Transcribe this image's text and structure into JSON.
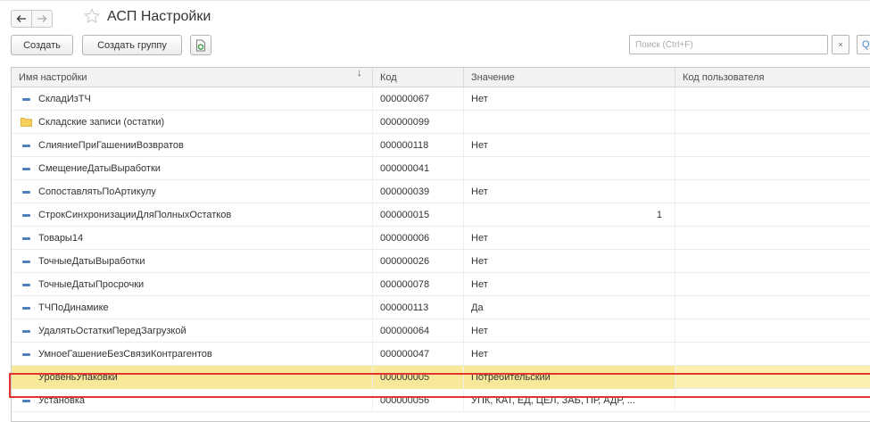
{
  "window": {
    "title": "АСП Настройки"
  },
  "toolbar": {
    "create_label": "Создать",
    "create_group_label": "Создать группу",
    "search_placeholder": "Поиск (Ctrl+F)",
    "clear_label": "×",
    "find_label": "Q"
  },
  "table": {
    "columns": {
      "name": "Имя настройки",
      "code": "Код",
      "value": "Значение",
      "user_code": "Код пользователя"
    },
    "sort_indicator": "↓",
    "rows": [
      {
        "icon": "setting-item-icon",
        "name": "СкладИзТЧ",
        "code": "000000067",
        "value": "Нет",
        "user_code": ""
      },
      {
        "icon": "folder-icon",
        "name": "Складские записи (остатки)",
        "code": "000000099",
        "value": "",
        "user_code": ""
      },
      {
        "icon": "setting-item-icon",
        "name": "СлияниеПриГашенииВозвратов",
        "code": "000000118",
        "value": "Нет",
        "user_code": ""
      },
      {
        "icon": "setting-item-icon",
        "name": "СмещениеДатыВыработки",
        "code": "000000041",
        "value": "",
        "user_code": ""
      },
      {
        "icon": "setting-item-icon",
        "name": "СопоставлятьПоАртикулу",
        "code": "000000039",
        "value": "Нет",
        "user_code": ""
      },
      {
        "icon": "setting-item-icon",
        "name": "СтрокСинхронизацииДляПолныхОстатков",
        "code": "000000015",
        "value": "1",
        "user_code": ""
      },
      {
        "icon": "setting-item-icon",
        "name": "Товары14",
        "code": "000000006",
        "value": "Нет",
        "user_code": ""
      },
      {
        "icon": "setting-item-icon",
        "name": "ТочныеДатыВыработки",
        "code": "000000026",
        "value": "Нет",
        "user_code": ""
      },
      {
        "icon": "setting-item-icon",
        "name": "ТочныеДатыПросрочки",
        "code": "000000078",
        "value": "Нет",
        "user_code": ""
      },
      {
        "icon": "setting-item-icon",
        "name": "ТЧПоДинамике",
        "code": "000000113",
        "value": "Да",
        "user_code": ""
      },
      {
        "icon": "setting-item-icon",
        "name": "УдалятьОстаткиПередЗагрузкой",
        "code": "000000064",
        "value": "Нет",
        "user_code": ""
      },
      {
        "icon": "setting-item-icon",
        "name": "УмноеГашениеБезСвязиКонтрагентов",
        "code": "000000047",
        "value": "Нет",
        "user_code": ""
      },
      {
        "icon": "setting-item-icon",
        "name": "УровеньУпаковки",
        "code": "000000005",
        "value": "Потребительский",
        "user_code": "",
        "selected": true
      },
      {
        "icon": "setting-item-icon",
        "name": "Установка",
        "code": "000000056",
        "value": "УПК, КАТ, ЕД, ЦЕЛ, ЗАБ, ПР, АДР, ...",
        "user_code": ""
      }
    ]
  },
  "colors": {
    "selection_fill": "#fbf0b0",
    "highlight_frame": "#e3342f",
    "item_icon": "#4f81bd",
    "folder_icon": "#f0c24a"
  }
}
